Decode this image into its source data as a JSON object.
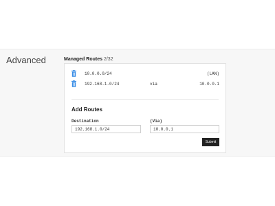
{
  "page": {
    "section_title": "Advanced"
  },
  "managed_routes": {
    "title": "Managed Routes",
    "count": "2/32",
    "routes": [
      {
        "destination": "10.0.0.0/24",
        "via_label": "",
        "gateway": "(LAN)",
        "icon": "trash-icon"
      },
      {
        "destination": "192.168.1.0/24",
        "via_label": "via",
        "gateway": "10.0.0.1",
        "icon": "trash-icon"
      }
    ]
  },
  "add_routes": {
    "title": "Add Routes",
    "destination_label": "Destination",
    "destination_value": "192.168.1.0/24",
    "via_label": "(Via)",
    "via_value": "10.0.0.1",
    "submit_label": "Submit"
  },
  "colors": {
    "trash_icon": "#3a8ee6",
    "submit_button": "#222222"
  }
}
